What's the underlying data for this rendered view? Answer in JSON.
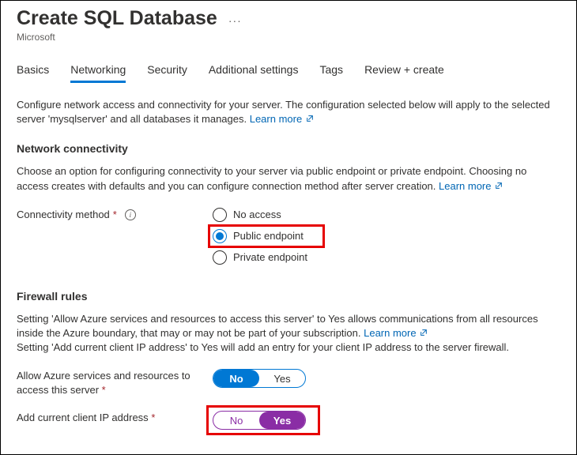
{
  "header": {
    "title": "Create SQL Database",
    "publisher": "Microsoft"
  },
  "tabs": {
    "basics": "Basics",
    "networking": "Networking",
    "security": "Security",
    "additional": "Additional settings",
    "tags": "Tags",
    "review": "Review + create"
  },
  "intro": {
    "text": "Configure network access and connectivity for your server. The configuration selected below will apply to the selected server 'mysqlserver' and all databases it manages. ",
    "learn": "Learn more"
  },
  "connectivity": {
    "heading": "Network connectivity",
    "desc_prefix": "Choose an option for configuring connectivity to your server via public endpoint or private endpoint. Choosing no access creates with defaults and you can configure connection method after server creation. ",
    "learn": "Learn more",
    "field_label": "Connectivity method",
    "options": {
      "none": "No access",
      "public": "Public endpoint",
      "private": "Private endpoint"
    }
  },
  "firewall": {
    "heading": "Firewall rules",
    "desc_a": "Setting 'Allow Azure services and resources to access this server' to Yes allows communications from all resources inside the Azure boundary, that may or may not be part of your subscription. ",
    "learn": "Learn more",
    "desc_b": "Setting 'Add current client IP address' to Yes will add an entry for your client IP address to the server firewall.",
    "allow_label": "Allow Azure services and resources to access this server",
    "addip_label": "Add current client IP address",
    "no": "No",
    "yes": "Yes"
  }
}
